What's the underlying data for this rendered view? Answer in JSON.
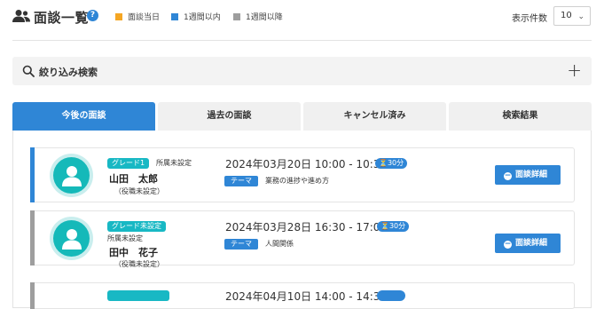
{
  "header": {
    "title": "面談一覧",
    "help_icon": "?",
    "legend": [
      {
        "label": "面談当日",
        "color": "#f5a623"
      },
      {
        "label": "1週間以内",
        "color": "#2f86d6"
      },
      {
        "label": "1週間以降",
        "color": "#9e9e9e"
      }
    ],
    "count_label": "表示件数",
    "count_value": "10"
  },
  "filter": {
    "label": "絞り込み検索",
    "expand_icon": "+"
  },
  "tabs": [
    {
      "label": "今後の面談",
      "active": true
    },
    {
      "label": "過去の面談",
      "active": false
    },
    {
      "label": "キャンセル済み",
      "active": false
    },
    {
      "label": "検索結果",
      "active": false
    }
  ],
  "interviews": [
    {
      "status_color": "#2f86d6",
      "grade": "グレード1",
      "department": "所属未設定",
      "name": "山田　太郎",
      "role": "（役職未設定）",
      "datetime": "2024年03月20日 10:00 - 10:30",
      "duration": "30分",
      "theme_label": "テーマ",
      "topic": "業務の進捗や進め方",
      "detail_label": "面談詳細"
    },
    {
      "status_color": "#9e9e9e",
      "grade": "グレード未設定",
      "department": "所属未設定",
      "name": "田中　花子",
      "role": "（役職未設定）",
      "datetime": "2024年03月28日 16:30 - 17:00",
      "duration": "30分",
      "theme_label": "テーマ",
      "topic": "人間関係",
      "detail_label": "面談詳細"
    }
  ],
  "partial_card": {
    "datetime": "2024年04月10日 14:00 - 14:30",
    "status_color": "#9e9e9e"
  }
}
